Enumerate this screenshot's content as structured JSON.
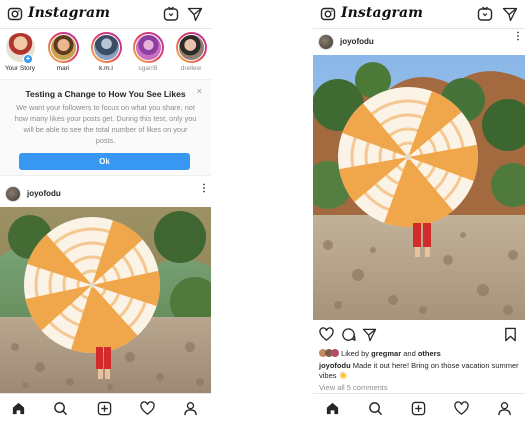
{
  "app": {
    "logo_text": "Instagram"
  },
  "left": {
    "stories": [
      {
        "name": "Your Story",
        "own": true
      },
      {
        "name": "mari"
      },
      {
        "name": "k.m.l"
      },
      {
        "name": "sgarrB"
      },
      {
        "name": "drellew"
      }
    ],
    "notice": {
      "title": "Testing a Change to How You See Likes",
      "body": "We want your followers to focus on what you share, not how many likes your posts get. During this test, only you will be able to see the total number of likes on your posts.",
      "button_label": "Ok",
      "close_symbol": "×"
    },
    "post": {
      "username": "joyofodu",
      "more_symbol": "⋮"
    }
  },
  "right": {
    "post": {
      "username": "joyofodu",
      "more_symbol": "⋮",
      "liked_by_prefix": "Liked by",
      "liked_by_user": "gregmar",
      "liked_by_and": "and",
      "liked_by_others": "others",
      "caption_user": "joyofodu",
      "caption_text": "Made it out here! Bring on those vacation summer vibes ☀️",
      "view_comments": "View all 5 comments"
    }
  },
  "icons": {
    "camera": "camera-icon",
    "tv": "igtv-icon",
    "direct": "direct-message-icon",
    "home": "home-icon",
    "search": "search-icon",
    "add": "add-post-icon",
    "activity": "heart-icon",
    "profile": "profile-icon",
    "like": "heart-icon",
    "comment": "comment-icon",
    "share": "share-icon",
    "save": "bookmark-icon"
  },
  "colors": {
    "accent": "#3897f0",
    "umbrella_orange": "#f0a64a",
    "umbrella_white": "#fbf3e6",
    "sky": "#8ab7e8"
  }
}
